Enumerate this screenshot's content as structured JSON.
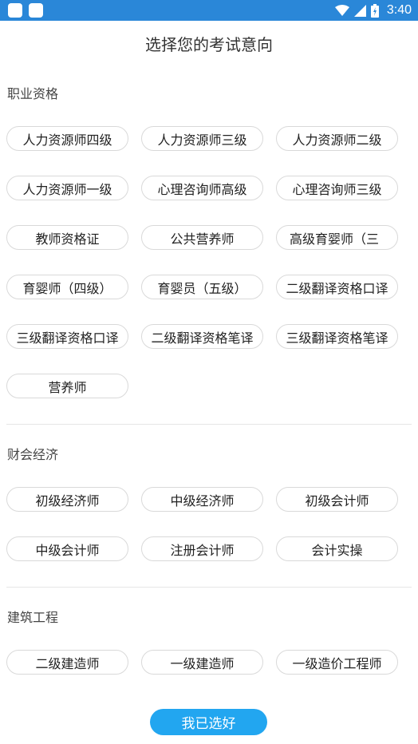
{
  "status_bar": {
    "time": "3:40",
    "icons": [
      "notification-icon",
      "notification-icon",
      "wifi-icon",
      "signal-icon",
      "battery-icon"
    ]
  },
  "header": {
    "title": "选择您的考试意向"
  },
  "sections": [
    {
      "title": "职业资格",
      "items": [
        "人力资源师四级",
        "人力资源师三级",
        "人力资源师二级",
        "人力资源师一级",
        "心理咨询师高级",
        "心理咨询师三级",
        "教师资格证",
        "公共营养师",
        "高级育婴师（三",
        "育婴师（四级）",
        "育婴员（五级）",
        "二级翻译资格口译",
        "三级翻译资格口译",
        "二级翻译资格笔译",
        "三级翻译资格笔译",
        "营养师"
      ]
    },
    {
      "title": "财会经济",
      "items": [
        "初级经济师",
        "中级经济师",
        "初级会计师",
        "中级会计师",
        "注册会计师",
        "会计实操"
      ]
    },
    {
      "title": "建筑工程",
      "items": [
        "二级建造师",
        "一级建造师",
        "一级造价工程师"
      ]
    }
  ],
  "footer": {
    "confirm_label": "我已选好"
  },
  "colors": {
    "status_bar": "#2a87d8",
    "accent": "#22a6f0",
    "chip_border": "#d9d9d9"
  }
}
